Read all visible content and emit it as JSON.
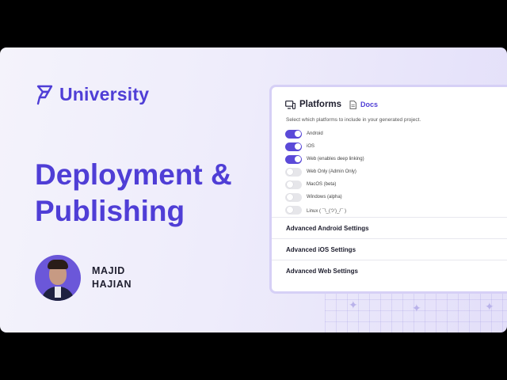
{
  "brand": {
    "name": "University"
  },
  "title": {
    "line1": "Deployment &",
    "line2": "Publishing"
  },
  "presenter": {
    "first_name": "MAJID",
    "last_name": "HAJIAN"
  },
  "panel": {
    "title": "Platforms",
    "docs_label": "Docs",
    "description": "Select which platforms to include in your generated project.",
    "platforms": [
      {
        "label": "Android",
        "enabled": true
      },
      {
        "label": "iOS",
        "enabled": true
      },
      {
        "label": "Web (enables deep linking)",
        "enabled": true
      },
      {
        "label": "Web Only (Admin Only)",
        "enabled": false
      },
      {
        "label": "MacOS (beta)",
        "enabled": false
      },
      {
        "label": "Windows (alpha)",
        "enabled": false
      },
      {
        "label": "Linux ( ¯\\_(ツ)_/¯ )",
        "enabled": false
      }
    ],
    "sections": [
      {
        "label": "Advanced Android Settings"
      },
      {
        "label": "Advanced iOS Settings"
      },
      {
        "label": "Advanced Web Settings"
      }
    ]
  },
  "colors": {
    "accent": "#4f3ed6",
    "toggle_on": "#5b4ad8",
    "toggle_off": "#e6e6ea"
  },
  "icons": {
    "brand": "university-logo-icon",
    "platforms": "monitor-phone-icon",
    "docs": "document-icon"
  }
}
